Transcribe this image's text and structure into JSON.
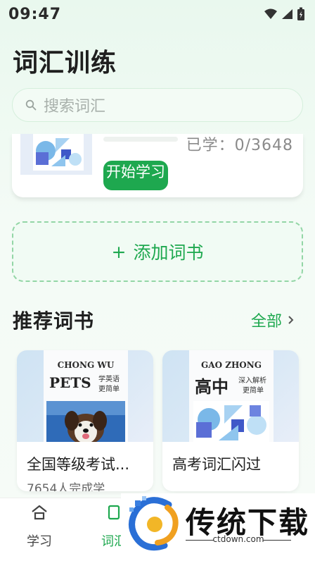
{
  "status_bar": {
    "time": "09:47"
  },
  "page_title": "词汇训练",
  "search": {
    "placeholder": "搜索词汇"
  },
  "current_book": {
    "learned_label": "已学：0/3648",
    "progress": 0,
    "start_button": "开始学习"
  },
  "add_book": {
    "icon": "+",
    "label": "添加词书"
  },
  "recommended": {
    "title": "推荐词书",
    "see_all": "全部",
    "books": [
      {
        "cover_title_top": "CHONG WU",
        "cover_title_main": "PETS",
        "cover_tagline_1": "学英语",
        "cover_tagline_2": "更简单",
        "name": "全国等级考试...",
        "subtitle": "7654人完成学"
      },
      {
        "cover_title_top": "GAO ZHONG",
        "cover_title_main": "高中",
        "cover_tagline_1": "深入解析",
        "cover_tagline_2": "更简单",
        "name": "高考词汇闪过",
        "subtitle": ""
      }
    ]
  },
  "bottom_nav": {
    "items": [
      {
        "label": "学习",
        "icon": "home-icon"
      },
      {
        "label": "词汇",
        "icon": "vocabulary-icon"
      }
    ]
  },
  "watermark": {
    "title": "传统下载",
    "url": "ctdown.com"
  },
  "colors": {
    "accent": "#1ea84f",
    "background": "#e9f8ee"
  }
}
